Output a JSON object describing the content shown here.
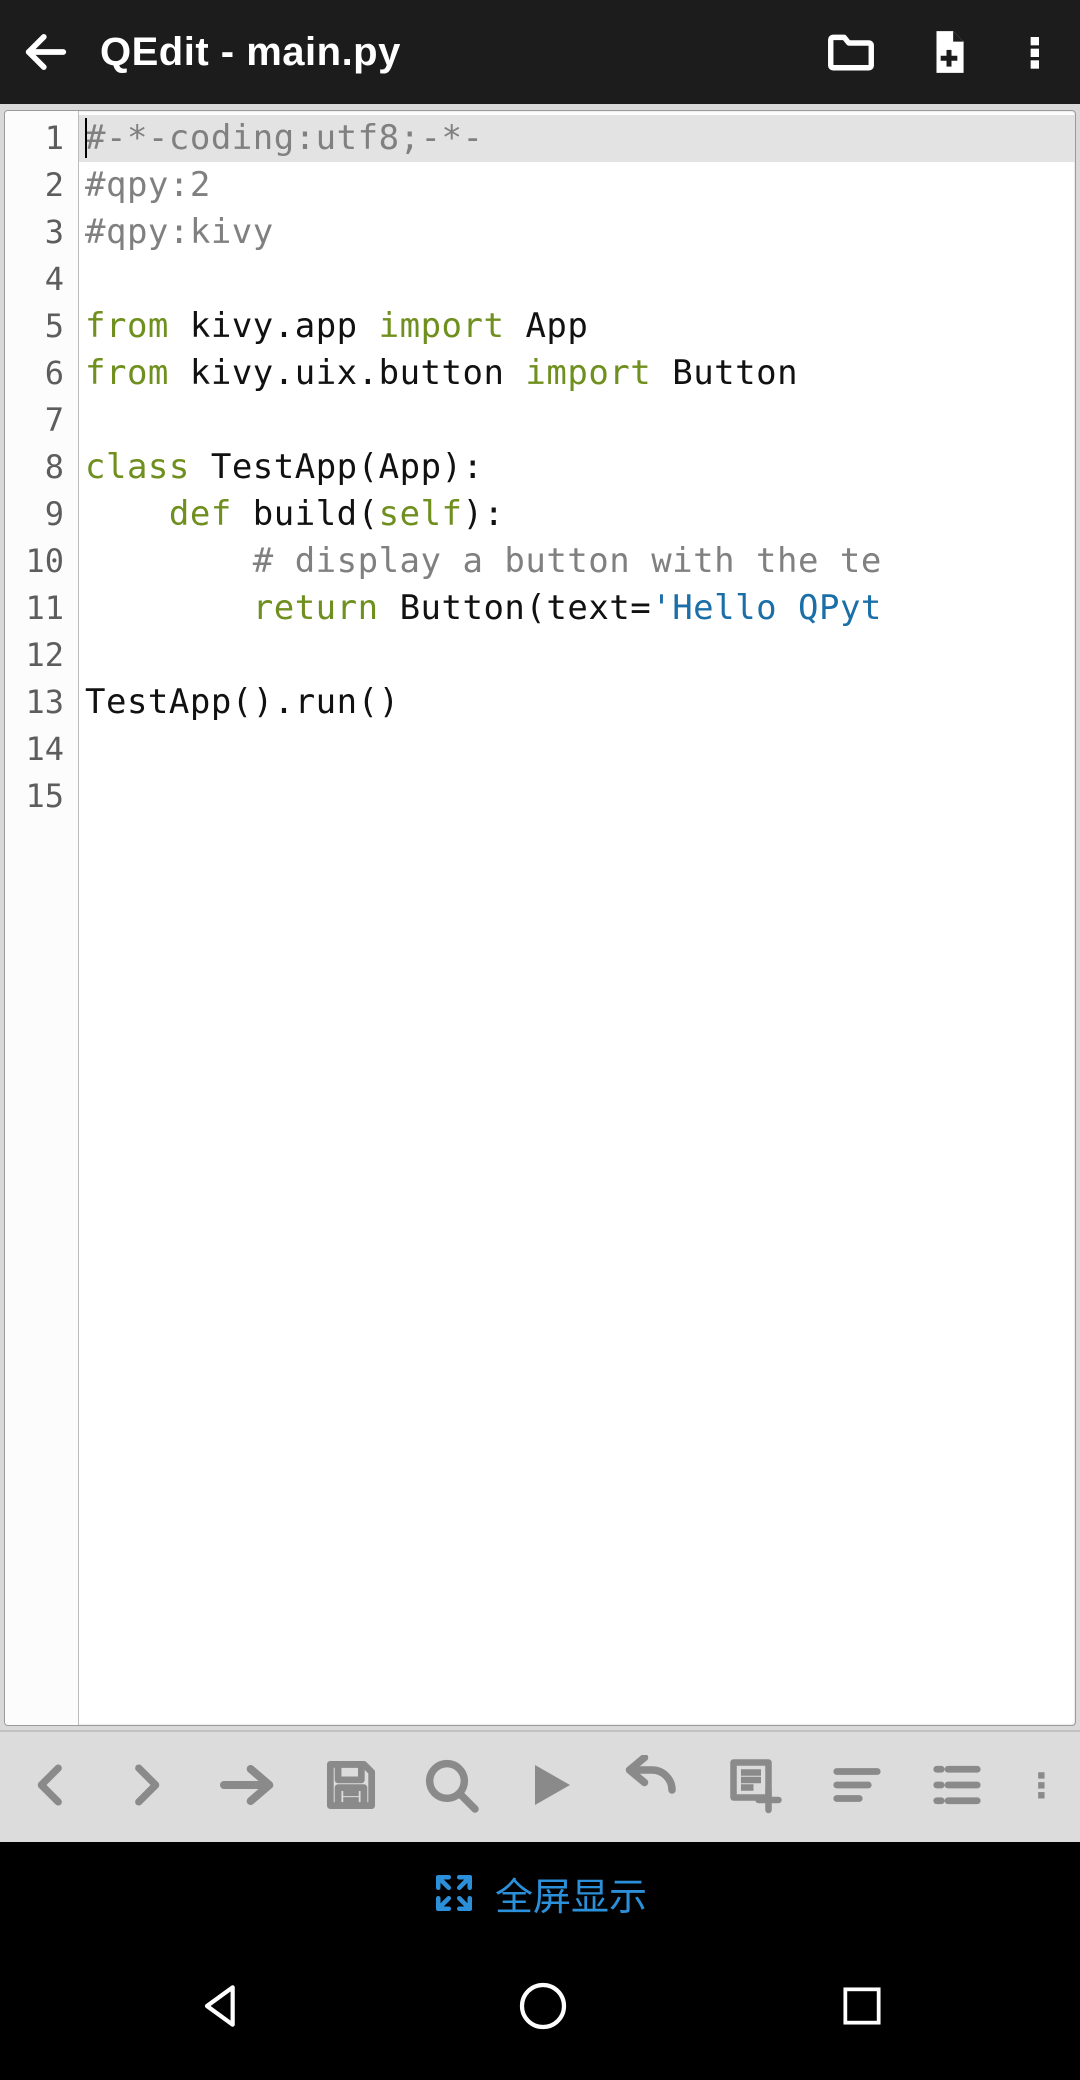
{
  "appbar": {
    "title": "QEdit - main.py"
  },
  "gutter": {
    "from": 1,
    "to": 15
  },
  "current_line": 1,
  "code_lines": [
    {
      "n": 1,
      "tokens": [
        {
          "c": "tok-comment",
          "t": "#-*-coding:utf8;-*-"
        }
      ]
    },
    {
      "n": 2,
      "tokens": [
        {
          "c": "tok-comment",
          "t": "#qpy:2"
        }
      ]
    },
    {
      "n": 3,
      "tokens": [
        {
          "c": "tok-comment",
          "t": "#qpy:kivy"
        }
      ]
    },
    {
      "n": 4,
      "tokens": []
    },
    {
      "n": 5,
      "tokens": [
        {
          "c": "tok-kw",
          "t": "from"
        },
        {
          "c": "tok-op",
          "t": " "
        },
        {
          "c": "tok-name",
          "t": "kivy.app"
        },
        {
          "c": "tok-op",
          "t": " "
        },
        {
          "c": "tok-kw",
          "t": "import"
        },
        {
          "c": "tok-op",
          "t": " "
        },
        {
          "c": "tok-name",
          "t": "App"
        }
      ]
    },
    {
      "n": 6,
      "tokens": [
        {
          "c": "tok-kw",
          "t": "from"
        },
        {
          "c": "tok-op",
          "t": " "
        },
        {
          "c": "tok-name",
          "t": "kivy.uix.button"
        },
        {
          "c": "tok-op",
          "t": " "
        },
        {
          "c": "tok-kw",
          "t": "import"
        },
        {
          "c": "tok-op",
          "t": " "
        },
        {
          "c": "tok-name",
          "t": "Button"
        }
      ]
    },
    {
      "n": 7,
      "tokens": []
    },
    {
      "n": 8,
      "tokens": [
        {
          "c": "tok-kw",
          "t": "class"
        },
        {
          "c": "tok-op",
          "t": " "
        },
        {
          "c": "tok-name",
          "t": "TestApp"
        },
        {
          "c": "tok-op",
          "t": "("
        },
        {
          "c": "tok-name",
          "t": "App"
        },
        {
          "c": "tok-op",
          "t": "):"
        }
      ]
    },
    {
      "n": 9,
      "tokens": [
        {
          "c": "tok-op",
          "t": "    "
        },
        {
          "c": "tok-kw",
          "t": "def"
        },
        {
          "c": "tok-op",
          "t": " "
        },
        {
          "c": "tok-name",
          "t": "build"
        },
        {
          "c": "tok-op",
          "t": "("
        },
        {
          "c": "tok-self",
          "t": "self"
        },
        {
          "c": "tok-op",
          "t": "):"
        }
      ]
    },
    {
      "n": 10,
      "tokens": [
        {
          "c": "tok-op",
          "t": "        "
        },
        {
          "c": "tok-comment",
          "t": "# display a button with the te"
        }
      ]
    },
    {
      "n": 11,
      "tokens": [
        {
          "c": "tok-op",
          "t": "        "
        },
        {
          "c": "tok-kw",
          "t": "return"
        },
        {
          "c": "tok-op",
          "t": " "
        },
        {
          "c": "tok-name",
          "t": "Button"
        },
        {
          "c": "tok-op",
          "t": "(text="
        },
        {
          "c": "tok-str",
          "t": "'Hello QPyt"
        }
      ]
    },
    {
      "n": 12,
      "tokens": []
    },
    {
      "n": 13,
      "tokens": [
        {
          "c": "tok-name",
          "t": "TestApp"
        },
        {
          "c": "tok-op",
          "t": "().run()"
        }
      ]
    },
    {
      "n": 14,
      "tokens": []
    },
    {
      "n": 15,
      "tokens": []
    }
  ],
  "hint": {
    "label": "全屏显示"
  },
  "icons": {
    "back": "back-arrow",
    "folder": "folder",
    "newfile": "new-file",
    "overflow": "overflow",
    "tools": [
      "chevron-left",
      "chevron-right",
      "arrow-right",
      "save",
      "search",
      "play",
      "undo",
      "snippet",
      "format",
      "list",
      "more-vertical"
    ],
    "expand": "expand",
    "nav": [
      "back",
      "home",
      "recent"
    ]
  },
  "colors": {
    "kw": "#6f8f1f",
    "comment": "#808080",
    "string": "#1b6fa8",
    "accent": "#2b90d9"
  }
}
